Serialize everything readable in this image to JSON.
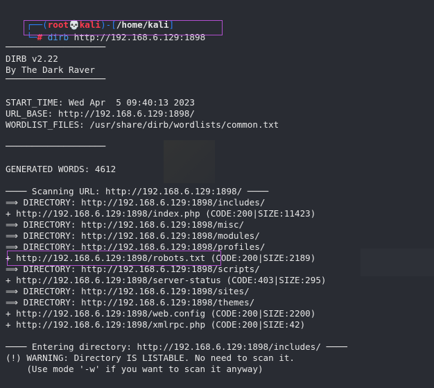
{
  "colors": {
    "background": "#292c33",
    "text": "#e6e6e6",
    "prompt_bracket": "#2d7ff9",
    "prompt_user": "#ff3b4f",
    "command": "#4b9df2",
    "highlight_box": "#b24fd0"
  },
  "prompt": {
    "top_corner": "┌──(",
    "user": "root",
    "skull": "💀",
    "host": "kali",
    "mid": ")-[",
    "path": "/home/kali",
    "close": "]",
    "bottom_corner": "└─",
    "hash": "#",
    "command_name": "dirb",
    "command_args": " http://192.168.6.129:1898"
  },
  "output": [
    "",
    "───────────────────",
    "DIRB v2.22",
    "By The Dark Raver",
    "───────────────────",
    "",
    "START_TIME: Wed Apr  5 09:40:13 2023",
    "URL_BASE: http://192.168.6.129:1898/",
    "WORDLIST_FILES: /usr/share/dirb/wordlists/common.txt",
    "",
    "───────────────────",
    "",
    "GENERATED WORDS: 4612",
    "",
    "──── Scanning URL: http://192.168.6.129:1898/ ────",
    "⟹ DIRECTORY: http://192.168.6.129:1898/includes/",
    "+ http://192.168.6.129:1898/index.php (CODE:200|SIZE:11423)",
    "⟹ DIRECTORY: http://192.168.6.129:1898/misc/",
    "⟹ DIRECTORY: http://192.168.6.129:1898/modules/",
    "⟹ DIRECTORY: http://192.168.6.129:1898/profiles/",
    "+ http://192.168.6.129:1898/robots.txt (CODE:200|SIZE:2189)",
    "⟹ DIRECTORY: http://192.168.6.129:1898/scripts/",
    "+ http://192.168.6.129:1898/server-status (CODE:403|SIZE:295)",
    "⟹ DIRECTORY: http://192.168.6.129:1898/sites/",
    "⟹ DIRECTORY: http://192.168.6.129:1898/themes/",
    "+ http://192.168.6.129:1898/web.config (CODE:200|SIZE:2200)",
    "+ http://192.168.6.129:1898/xmlrpc.php (CODE:200|SIZE:42)",
    "",
    "──── Entering directory: http://192.168.6.129:1898/includes/ ────",
    "(!) WARNING: Directory IS LISTABLE. No need to scan it.",
    "    (Use mode '-w' if you want to scan it anyway)"
  ]
}
